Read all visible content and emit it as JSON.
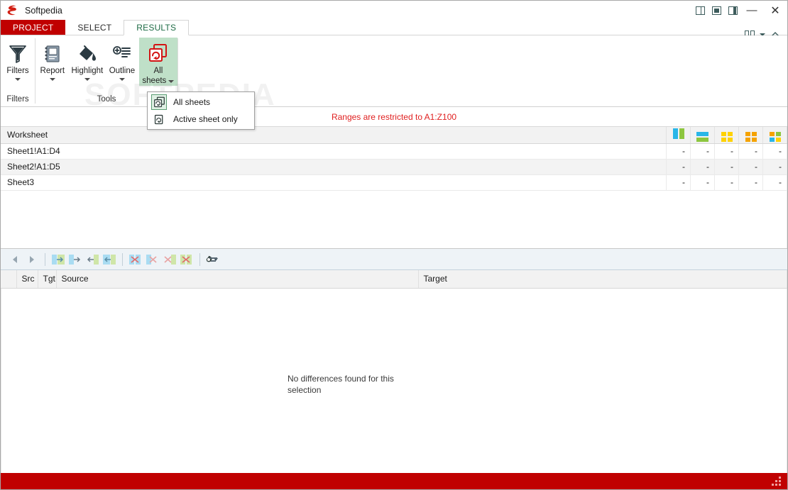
{
  "window": {
    "title": "Softpedia",
    "logo_icon": "softpedia-s-logo",
    "buttons": {
      "layout_split_label": "layout-split-icon",
      "layout_center_label": "layout-center-icon",
      "layout_right_label": "layout-right-icon",
      "minimize_label": "—",
      "close_label": "✕"
    }
  },
  "tabs": [
    {
      "id": "project",
      "label": "PROJECT",
      "active": false
    },
    {
      "id": "select",
      "label": "SELECT",
      "active": false
    },
    {
      "id": "results",
      "label": "RESULTS",
      "active": true
    }
  ],
  "tabstrip_right": {
    "columns_icon": "mini-columns-icon",
    "caret_icon": "chevron-down-icon",
    "collapse_icon": "chevron-up-icon"
  },
  "ribbon": {
    "groups": [
      {
        "name": "filters",
        "label": "Filters",
        "items": [
          {
            "name": "filters",
            "label": "Filters",
            "icon": "funnel-icon",
            "dropdown": true,
            "active": false
          }
        ]
      },
      {
        "name": "tools",
        "label": "Tools",
        "items": [
          {
            "name": "report",
            "label": "Report",
            "icon": "report-book-icon",
            "dropdown": true,
            "active": false
          },
          {
            "name": "highlight",
            "label": "Highlight",
            "icon": "paint-bucket-icon",
            "dropdown": true,
            "active": false
          },
          {
            "name": "outline",
            "label": "Outline",
            "icon": "outline-list-icon",
            "dropdown": true,
            "active": false
          },
          {
            "name": "all-sheets",
            "label": "All",
            "label2": "sheets",
            "icon": "all-sheets-icon",
            "dropdown": true,
            "active": true
          }
        ]
      }
    ]
  },
  "dropdown_menu": {
    "open": true,
    "items": [
      {
        "name": "all-sheets",
        "label": "All sheets",
        "icon": "all-sheets-icon",
        "selected": true
      },
      {
        "name": "active-sheet-only",
        "label": "Active sheet only",
        "icon": "single-sheet-icon",
        "selected": false
      }
    ]
  },
  "notice": {
    "text": "Ranges are restricted to A1:Z100",
    "color": "#e02020"
  },
  "watermark": {
    "text": "SOFTPEDIA"
  },
  "worksheet_table": {
    "columns": [
      {
        "name": "worksheet",
        "label": "Worksheet",
        "type": "text"
      },
      {
        "name": "col-sideby",
        "icon": "swatch-two-bars-icon",
        "type": "swatch"
      },
      {
        "name": "col-stacked",
        "icon": "swatch-two-rows-icon",
        "type": "swatch"
      },
      {
        "name": "col-grid-yellow",
        "icon": "swatch-grid-yellow-icon",
        "type": "swatch"
      },
      {
        "name": "col-grid-orange",
        "icon": "swatch-grid-orange-icon",
        "type": "swatch"
      },
      {
        "name": "col-grid-mixed",
        "icon": "swatch-grid-mixed-icon",
        "type": "swatch"
      }
    ],
    "swatch_colors": {
      "cyan": "#29b6e8",
      "green": "#8dc63f",
      "yellow": "#ffd200",
      "orange": "#f5a300",
      "blue": "#29b6e8",
      "highlight_cell": "#bfe3cd"
    },
    "rows": [
      {
        "worksheet": "Sheet1!A1:D4",
        "values": [
          "-",
          "-",
          "-",
          "-",
          "-"
        ],
        "highlight_index": null
      },
      {
        "worksheet": "Sheet2!A1:D5",
        "values": [
          "-",
          "-",
          "-",
          "-",
          "-"
        ],
        "highlight_index": 0
      },
      {
        "worksheet": "Sheet3",
        "values": [
          "-",
          "-",
          "-",
          "-",
          "-"
        ],
        "highlight_index": null
      }
    ]
  },
  "mid_toolbar": {
    "buttons": [
      {
        "name": "nav-previous",
        "icon": "triangle-left-icon"
      },
      {
        "name": "nav-next",
        "icon": "triangle-right-icon"
      },
      {
        "name": "copy-to-target-all",
        "icon": "arrow-right-block-icon"
      },
      {
        "name": "copy-to-target",
        "icon": "arrow-right-icon"
      },
      {
        "name": "copy-to-source",
        "icon": "arrow-left-icon"
      },
      {
        "name": "copy-to-source-all",
        "icon": "arrow-left-block-icon"
      },
      {
        "name": "ignore-target-all",
        "icon": "x-block-left-icon"
      },
      {
        "name": "ignore-target",
        "icon": "x-left-icon"
      },
      {
        "name": "ignore-source",
        "icon": "x-right-icon"
      },
      {
        "name": "ignore-source-all",
        "icon": "x-block-right-icon"
      },
      {
        "name": "settings",
        "icon": "gear-icon",
        "dropdown": true
      }
    ],
    "expander_icon": "collapse-handle-icon"
  },
  "diff_table": {
    "columns": [
      {
        "name": "col-indicator",
        "label": ""
      },
      {
        "name": "col-src",
        "label": "Src"
      },
      {
        "name": "col-tgt",
        "label": "Tgt"
      },
      {
        "name": "col-source",
        "label": "Source"
      },
      {
        "name": "col-target",
        "label": "Target"
      }
    ],
    "rows": [],
    "empty_message": "No differences found for this selection"
  },
  "statusbar": {
    "color": "#c00000",
    "grip_icon": "resize-grip-icon"
  }
}
